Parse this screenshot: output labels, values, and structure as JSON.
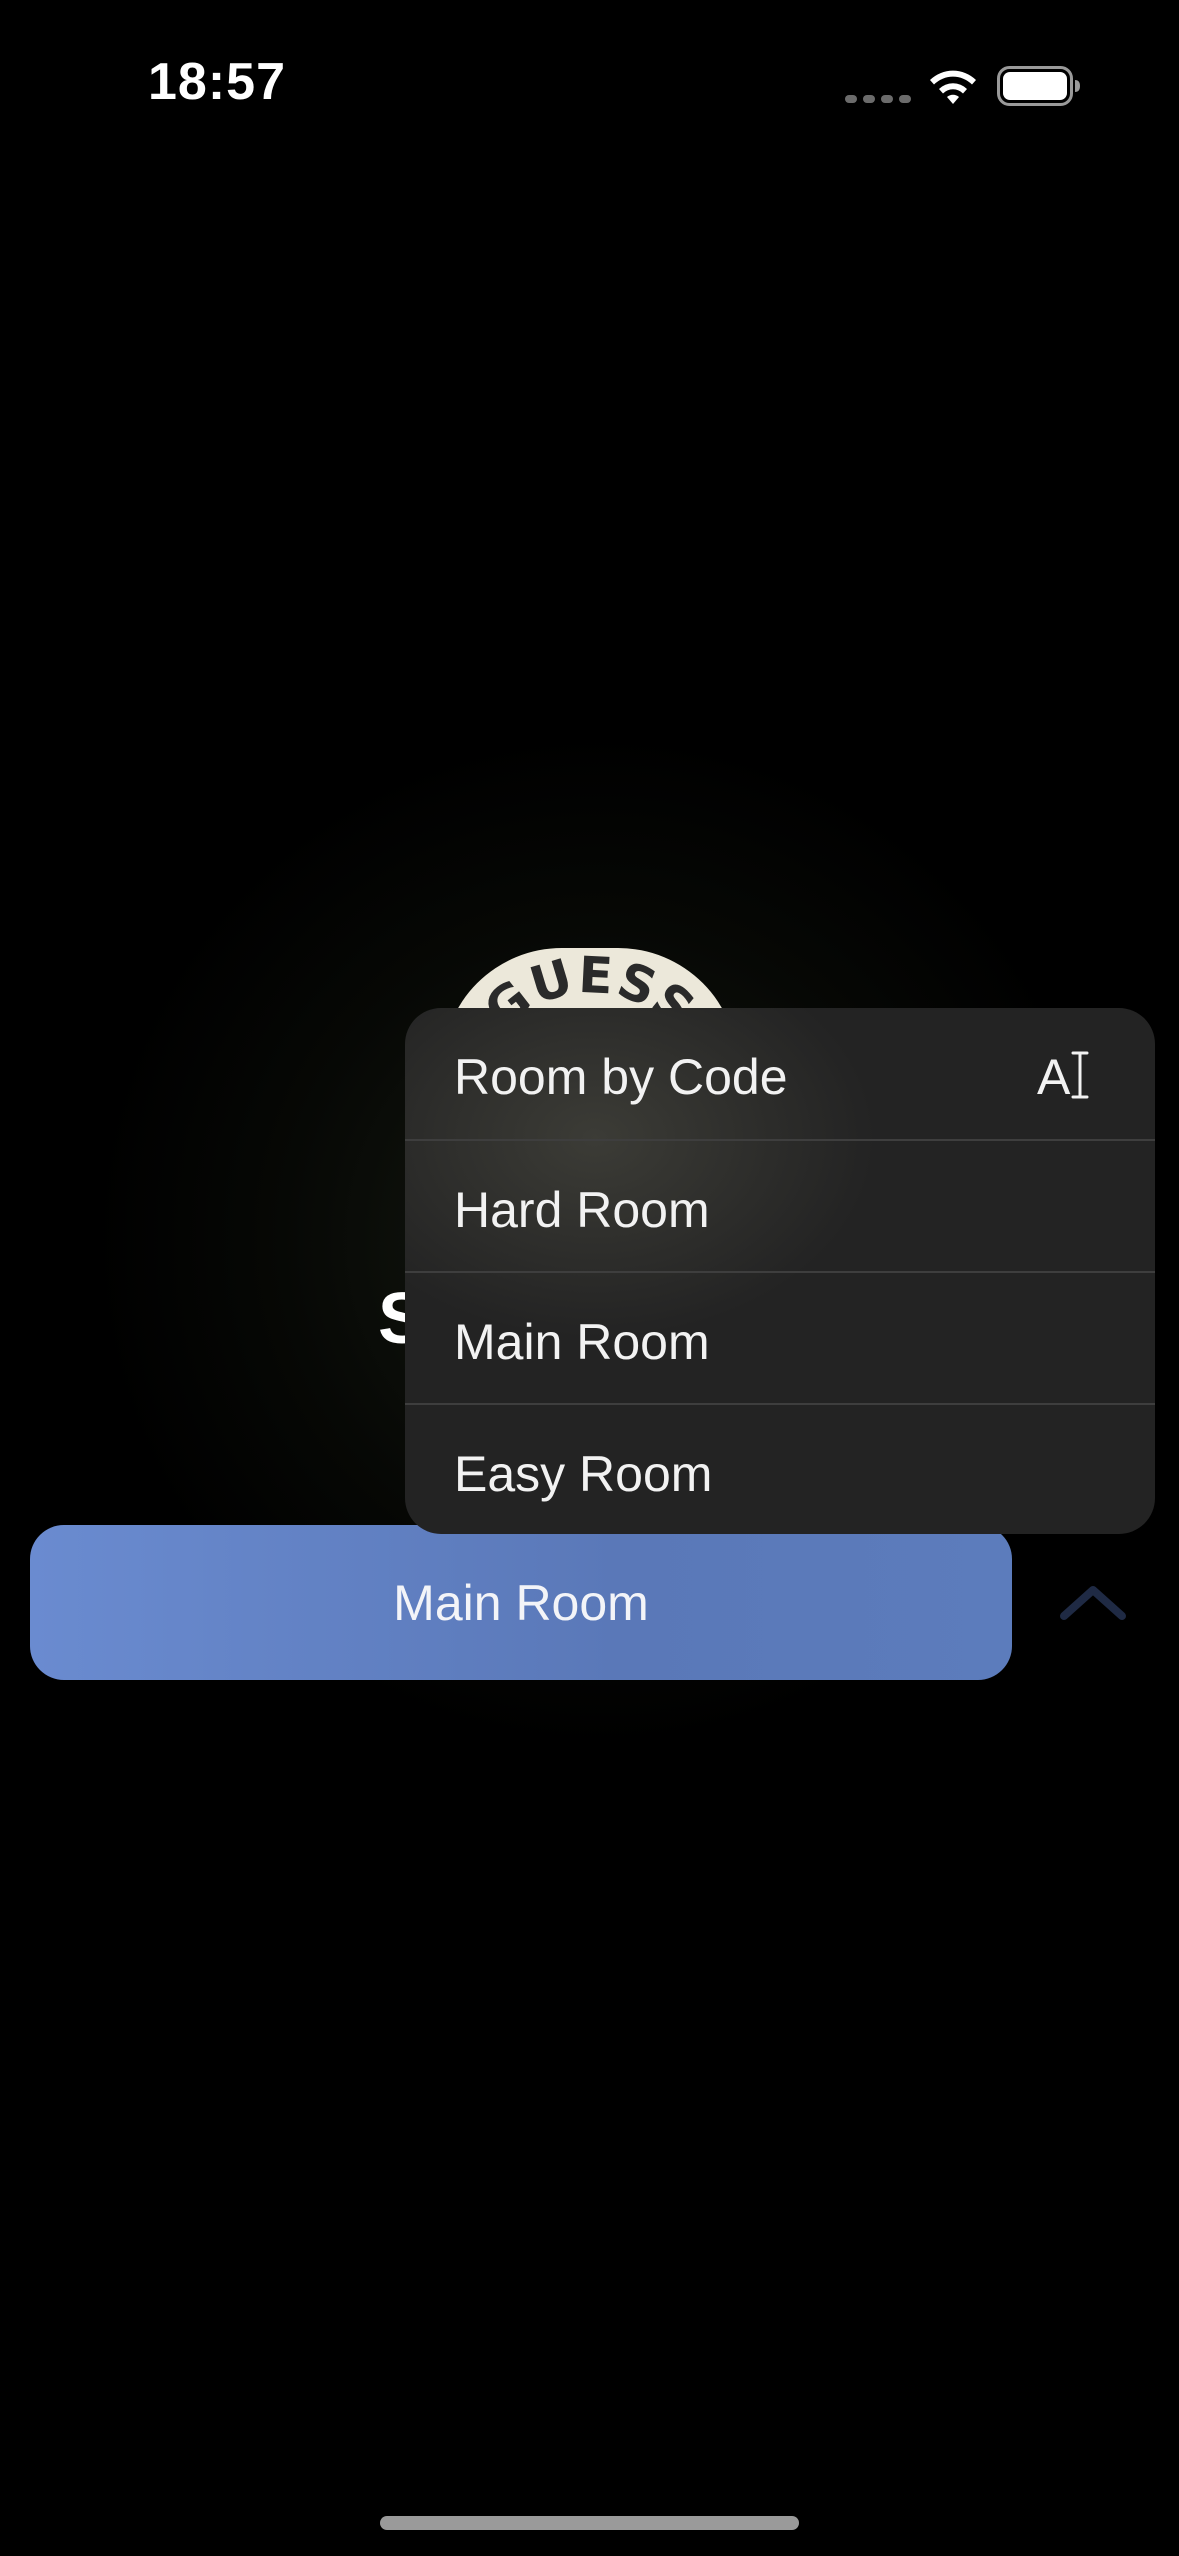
{
  "status_bar": {
    "time": "18:57",
    "icons": [
      "cellular-dots-icon",
      "wifi-icon",
      "battery-icon"
    ]
  },
  "logo": {
    "text": "GUESS",
    "background_color": "#ece8da",
    "text_color": "#2a2a2a"
  },
  "heading_fragment": "S",
  "dropdown_menu": {
    "items": [
      {
        "label": "Room by Code",
        "trailing_icon": "text-format-icon",
        "trailing_glyph": "A"
      },
      {
        "label": "Hard Room"
      },
      {
        "label": "Main Room"
      },
      {
        "label": "Easy Room"
      }
    ],
    "background_color": "#232323",
    "divider_color": "#3e3e3e"
  },
  "room_button": {
    "label": "Main Room",
    "color": "#5f7fc2",
    "toggle_icon": "chevron-up-icon"
  },
  "colors": {
    "background": "#000000",
    "chevron": "#1f2a44"
  }
}
